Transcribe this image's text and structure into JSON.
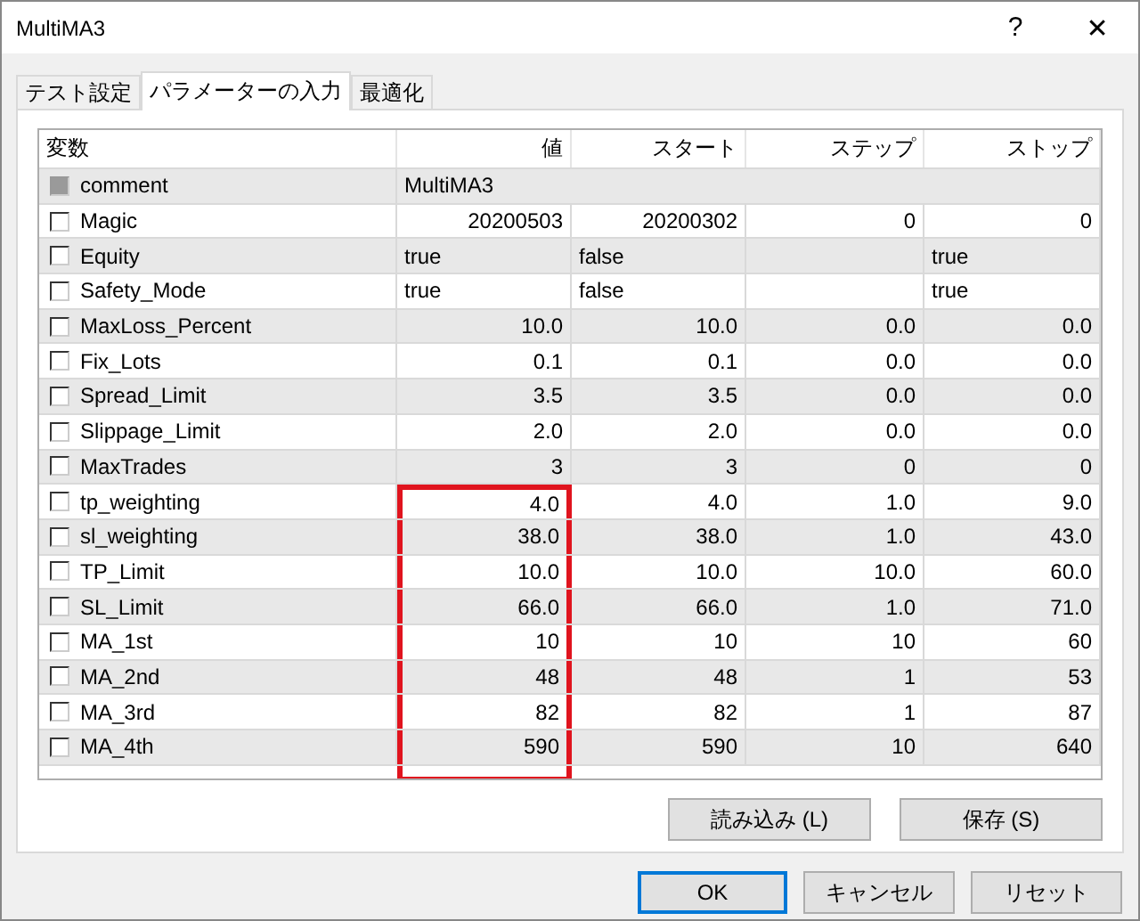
{
  "window": {
    "title": "MultiMA3",
    "help": "?",
    "close": "✕"
  },
  "tabs": [
    {
      "label": "テスト設定",
      "selected": false
    },
    {
      "label": "パラメーターの入力",
      "selected": true
    },
    {
      "label": "最適化",
      "selected": false
    }
  ],
  "table": {
    "columns": [
      "変数",
      "値",
      "スタート",
      "ステップ",
      "ストップ"
    ],
    "rows": [
      {
        "kind": "text",
        "checked": false,
        "disabled": true,
        "highlighted": false,
        "cells": [
          "comment",
          "MultiMA3"
        ]
      },
      {
        "kind": "number",
        "checked": false,
        "disabled": false,
        "highlighted": false,
        "cells": [
          "Magic",
          "20200503",
          "20200302",
          "0",
          "0"
        ]
      },
      {
        "kind": "bool",
        "checked": false,
        "disabled": false,
        "highlighted": false,
        "cells": [
          "Equity",
          "true",
          "false",
          "",
          "true"
        ]
      },
      {
        "kind": "bool",
        "checked": false,
        "disabled": false,
        "highlighted": false,
        "cells": [
          "Safety_Mode",
          "true",
          "false",
          "",
          "true"
        ]
      },
      {
        "kind": "number",
        "checked": false,
        "disabled": false,
        "highlighted": false,
        "cells": [
          "MaxLoss_Percent",
          "10.0",
          "10.0",
          "0.0",
          "0.0"
        ]
      },
      {
        "kind": "number",
        "checked": false,
        "disabled": false,
        "highlighted": false,
        "cells": [
          "Fix_Lots",
          "0.1",
          "0.1",
          "0.0",
          "0.0"
        ]
      },
      {
        "kind": "number",
        "checked": false,
        "disabled": false,
        "highlighted": false,
        "cells": [
          "Spread_Limit",
          "3.5",
          "3.5",
          "0.0",
          "0.0"
        ]
      },
      {
        "kind": "number",
        "checked": false,
        "disabled": false,
        "highlighted": false,
        "cells": [
          "Slippage_Limit",
          "2.0",
          "2.0",
          "0.0",
          "0.0"
        ]
      },
      {
        "kind": "number",
        "checked": false,
        "disabled": false,
        "highlighted": false,
        "cells": [
          "MaxTrades",
          "3",
          "3",
          "0",
          "0"
        ]
      },
      {
        "kind": "number",
        "checked": false,
        "disabled": false,
        "highlighted": true,
        "cells": [
          "tp_weighting",
          "4.0",
          "4.0",
          "1.0",
          "9.0"
        ]
      },
      {
        "kind": "number",
        "checked": false,
        "disabled": false,
        "highlighted": true,
        "cells": [
          "sl_weighting",
          "38.0",
          "38.0",
          "1.0",
          "43.0"
        ]
      },
      {
        "kind": "number",
        "checked": false,
        "disabled": false,
        "highlighted": true,
        "cells": [
          "TP_Limit",
          "10.0",
          "10.0",
          "10.0",
          "60.0"
        ]
      },
      {
        "kind": "number",
        "checked": false,
        "disabled": false,
        "highlighted": true,
        "cells": [
          "SL_Limit",
          "66.0",
          "66.0",
          "1.0",
          "71.0"
        ]
      },
      {
        "kind": "number",
        "checked": false,
        "disabled": false,
        "highlighted": true,
        "cells": [
          "MA_1st",
          "10",
          "10",
          "10",
          "60"
        ]
      },
      {
        "kind": "number",
        "checked": false,
        "disabled": false,
        "highlighted": true,
        "cells": [
          "MA_2nd",
          "48",
          "48",
          "1",
          "53"
        ]
      },
      {
        "kind": "number",
        "checked": false,
        "disabled": false,
        "highlighted": true,
        "cells": [
          "MA_3rd",
          "82",
          "82",
          "1",
          "87"
        ]
      },
      {
        "kind": "number",
        "checked": false,
        "disabled": false,
        "highlighted": true,
        "cells": [
          "MA_4th",
          "590",
          "590",
          "10",
          "640"
        ]
      }
    ]
  },
  "panel_buttons": [
    "読み込み (L)",
    "保存 (S)"
  ],
  "dialog_buttons": [
    {
      "label": "OK",
      "default": true
    },
    {
      "label": "キャンセル",
      "default": false
    },
    {
      "label": "リセット",
      "default": false
    }
  ]
}
